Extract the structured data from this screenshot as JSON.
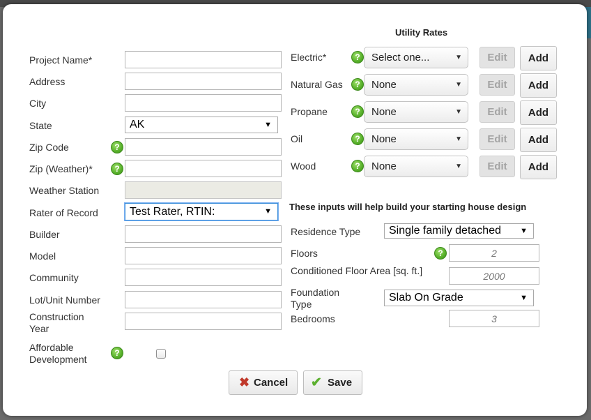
{
  "form": {
    "project_name_label": "Project Name*",
    "address_label": "Address",
    "city_label": "City",
    "state_label": "State",
    "state_value": "AK",
    "zip_label": "Zip Code",
    "zip_weather_label": "Zip (Weather)*",
    "weather_station_label": "Weather Station",
    "rater_label": "Rater of Record",
    "rater_value": "Test Rater, RTIN:",
    "builder_label": "Builder",
    "model_label": "Model",
    "community_label": "Community",
    "lot_label": "Lot/Unit Number",
    "construction_year_label": "Construction Year",
    "affordable_label": "Affordable Development"
  },
  "utility": {
    "heading": "Utility Rates",
    "edit_label": "Edit",
    "add_label": "Add",
    "rows": [
      {
        "label": "Electric*",
        "value": "Select one..."
      },
      {
        "label": "Natural Gas",
        "value": "None"
      },
      {
        "label": "Propane",
        "value": "None"
      },
      {
        "label": "Oil",
        "value": "None"
      },
      {
        "label": "Wood",
        "value": "None"
      }
    ]
  },
  "design": {
    "heading": "These inputs will help build your starting house design",
    "residence_type_label": "Residence Type",
    "residence_type_value": "Single family detached",
    "floors_label": "Floors",
    "floors_placeholder": "2",
    "cfa_label": "Conditioned Floor Area [sq. ft.]",
    "cfa_placeholder": "2000",
    "foundation_label": "Foundation Type",
    "foundation_value": "Slab On Grade",
    "bedrooms_label": "Bedrooms",
    "bedrooms_placeholder": "3"
  },
  "actions": {
    "cancel_label": "Cancel",
    "save_label": "Save"
  },
  "icons": {
    "help": "help-icon",
    "caret": "chevron-down-icon",
    "cancel": "x-icon",
    "save": "checkmark-icon"
  },
  "colors": {
    "help_green": "#57b02a",
    "cancel_red": "#c0392b",
    "save_green": "#5cb030",
    "focus_blue": "#3b8fd9"
  }
}
